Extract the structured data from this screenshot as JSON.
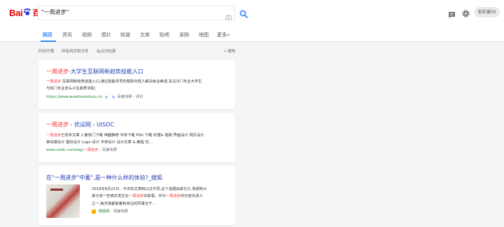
{
  "logo": {
    "bai": "Bai",
    "du": "百度"
  },
  "search": {
    "query": "\"一周进步\""
  },
  "user": {
    "badge": "彭彩姜05"
  },
  "tabs": [
    {
      "label": "网页",
      "active": true
    },
    {
      "label": "资讯"
    },
    {
      "label": "视频"
    },
    {
      "label": "图片"
    },
    {
      "label": "知道"
    },
    {
      "label": "文库"
    },
    {
      "label": "贴吧"
    },
    {
      "label": "采购"
    },
    {
      "label": "地图"
    },
    {
      "label": "更多»"
    }
  ],
  "filters": {
    "time": "时间不限",
    "type": "所有网页和文件",
    "site": "站点内检索",
    "search_tools": "⌕ 搜狗"
  },
  "results": [
    {
      "title_hl": "一周进步",
      "title_rest": "-大学生互联网新趋势技能入口",
      "abstract_hl": "一周进步",
      "abstract_rest_1": "-互联网新趋势技能入口,通过技能尽早的帮助年轻人解决就业焦虑,关注冷门专业大学生",
      "abstract_rest_2": "与热门专业非头子生跨界求职;",
      "url": "https://www.weekleesekup.cn/",
      "meta": "百度快照 - 评价"
    },
    {
      "title_hl": "一周进步",
      "title_rest": " - 优设网 - UISDC",
      "abstract_hl": "一周进步",
      "abstract_rest_1": "已发布文章 1 篇热门下载 神器推荐 字体下载 PSD 下载 纹理& 笔刷 界面设计 网页设计",
      "abstract_rest_2": "移动端设计 图标设计 Logo 设计 字体设计 设计文章 & 教程 优...",
      "url": "www.uisdc.com/tag/",
      "url_hl": "一周进步",
      "meta": "- 百度快照"
    },
    {
      "title_pre": "在\"一周进步\"中蓄\",是一种什么样的体验?_搜狐",
      "abstract_line_1": "2018年6月21日 - 今天的文章和以往不同,这个选题由来已久,我想和大",
      "abstract_line_2a": "家分享一些真实发生在",
      "abstract_line_2_hl": "一周进步",
      "abstract_line_2b": "的故事。作为",
      "abstract_line_2_hl2": "一周进步",
      "abstract_line_2c": "的内容负责人",
      "abstract_line_3": "之一,每天我都能看到身边的同事在干...",
      "source": "搜狐网",
      "meta": "- 百度快照"
    }
  ],
  "colors": {
    "accent": "#3388ff",
    "link": "#2440b3",
    "highlight": "#f73131",
    "url": "#1a8a3a"
  },
  "icons": [
    "camera-icon",
    "search-icon",
    "message-icon",
    "gear-icon",
    "paw-icon"
  ]
}
